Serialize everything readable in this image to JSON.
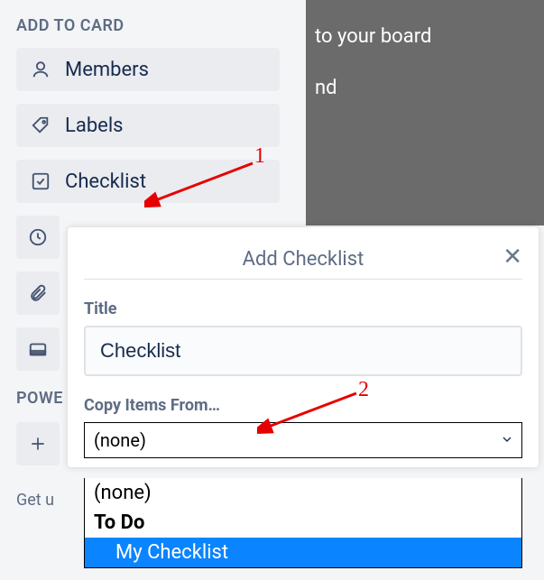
{
  "background": {
    "line1": "to your board",
    "line2": "nd"
  },
  "sidebar": {
    "section_title": "ADD TO CARD",
    "members": "Members",
    "labels": "Labels",
    "checklist": "Checklist",
    "powerups_title": "POWE",
    "footer": "Get u"
  },
  "popover": {
    "title": "Add Checklist",
    "title_field_label": "Title",
    "title_field_value": "Checklist",
    "copy_label": "Copy Items From…",
    "selected": "(none)",
    "options": {
      "none": "(none)",
      "todo": "To Do",
      "my_checklist": "My Checklist"
    }
  },
  "annotations": {
    "one": "1",
    "two": "2"
  }
}
